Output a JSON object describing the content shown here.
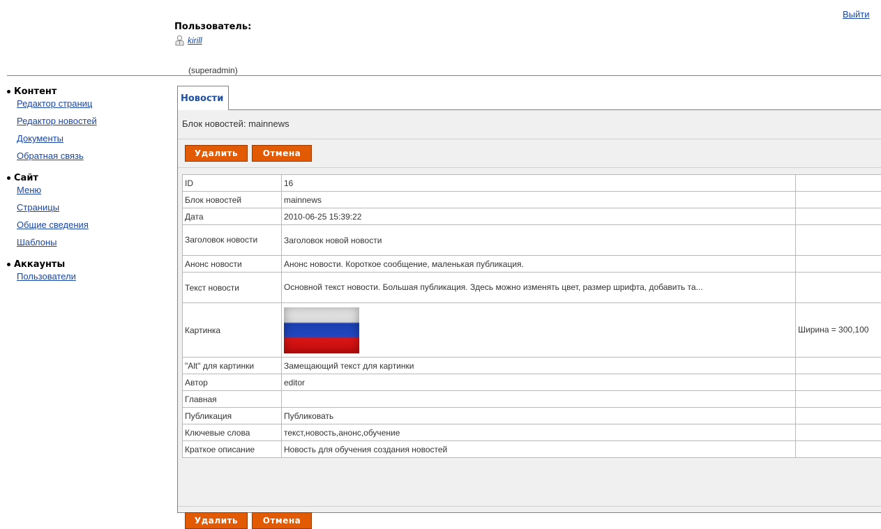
{
  "header": {
    "logout_label": "Выйти",
    "user_title": "Пользователь:",
    "user_name": "kirill",
    "user_role": "(superadmin)"
  },
  "sidebar": {
    "groups": [
      {
        "title": "Контент",
        "links": [
          "Редактор страниц",
          "Редактор новостей",
          "Документы",
          "Обратная связь"
        ]
      },
      {
        "title": "Сайт",
        "links": [
          "Меню",
          "Страницы",
          "Общие сведения",
          "Шаблоны"
        ]
      },
      {
        "title": "Аккаунты",
        "links": [
          "Пользователи"
        ]
      }
    ]
  },
  "main": {
    "tab_label": "Новости",
    "block_label": "Блок новостей: mainnews",
    "buttons": {
      "delete_label": "Удалить",
      "cancel_label": "Отмена"
    },
    "rows": [
      {
        "label": "ID",
        "value": "16",
        "extra": ""
      },
      {
        "label": "Блок новостей",
        "value": "mainnews",
        "extra": ""
      },
      {
        "label": "Дата",
        "value": "2010-06-25 15:39:22",
        "extra": ""
      },
      {
        "label": "Заголовок новости",
        "value": "Заголовок новой новости",
        "extra": ""
      },
      {
        "label": "Анонс новости",
        "value": "Анонс новости. Короткое сообщение, маленькая публикация.",
        "extra": ""
      },
      {
        "label": "Текст новости",
        "value": "Основной текст новости. Большая публикация. Здесь можно изменять цвет, размер шрифта, добавить та...",
        "extra": ""
      },
      {
        "label": "Картинка",
        "value": "",
        "extra": "Ширина = 300,100",
        "image": "russian-flag"
      },
      {
        "label": "\"Alt\" для картинки",
        "value": "Замещающий текст для картинки",
        "extra": ""
      },
      {
        "label": "Автор",
        "value": "editor",
        "extra": ""
      },
      {
        "label": "Главная",
        "value": "",
        "extra": ""
      },
      {
        "label": "Публикация",
        "value": "Публиковать",
        "extra": ""
      },
      {
        "label": "Ключевые слова",
        "value": "текст,новость,анонс,обучение",
        "extra": ""
      },
      {
        "label": "Краткое описание",
        "value": "Новость для обучения создания новостей",
        "extra": ""
      }
    ]
  },
  "colors": {
    "button_bg": "#e35a05",
    "link": "#1a46a8",
    "tab_text": "#1e4fa0"
  }
}
